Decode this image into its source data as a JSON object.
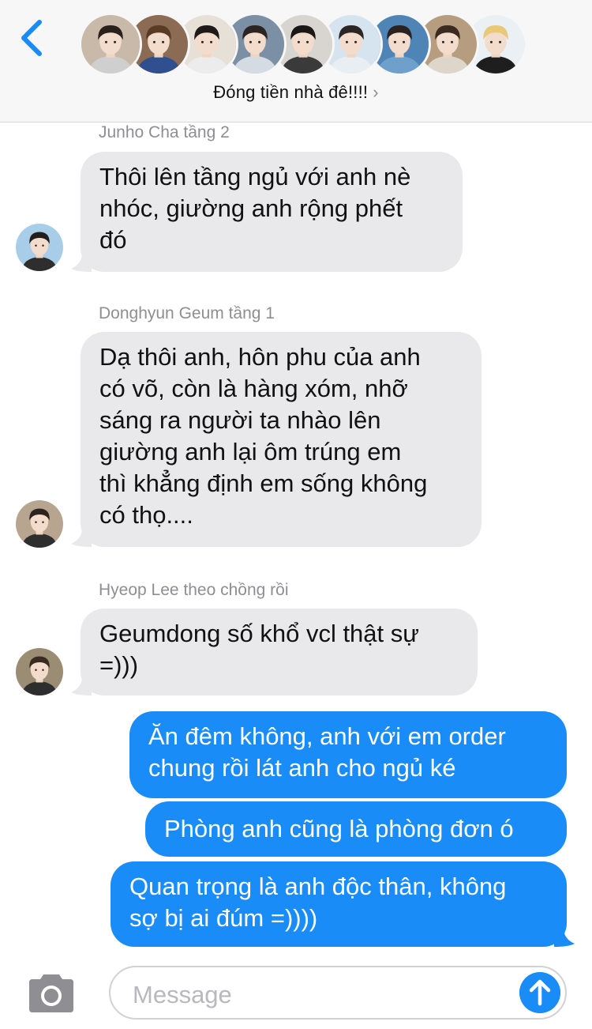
{
  "header": {
    "back_label": "Back",
    "group_name": "Đóng tiền nhà đê!!!!",
    "chevron": "›",
    "member_avatars": [
      {
        "icon": "avatar-1",
        "bg": "#c9b9a9",
        "hair": "#2b211c",
        "shirt": "#cfcfcf"
      },
      {
        "icon": "avatar-2",
        "bg": "#8b6b53",
        "hair": "#5a3b23",
        "shirt": "#2f4f8f"
      },
      {
        "icon": "avatar-3",
        "bg": "#e7e0d6",
        "hair": "#1f1a18",
        "shirt": "#ececec"
      },
      {
        "icon": "avatar-4",
        "bg": "#7b8fa5",
        "hair": "#2c2420",
        "shirt": "#d5dbe3"
      },
      {
        "icon": "avatar-5",
        "bg": "#d8d4cf",
        "hair": "#1b1716",
        "shirt": "#3a3a3a"
      },
      {
        "icon": "avatar-6",
        "bg": "#d6e4ef",
        "hair": "#2b2523",
        "shirt": "#e9eef2"
      },
      {
        "icon": "avatar-7",
        "bg": "#4f85b6",
        "hair": "#2a2220",
        "shirt": "#6fa0cc"
      },
      {
        "icon": "avatar-8",
        "bg": "#b79d80",
        "hair": "#3b2a1f",
        "shirt": "#ded6cb"
      },
      {
        "icon": "avatar-9",
        "bg": "#eaf0f4",
        "hair": "#e7c977",
        "shirt": "#1e1e1e"
      }
    ]
  },
  "messages": [
    {
      "type": "in",
      "sender": "Junho Cha tầng 2",
      "lines": [
        "Thôi lên tầng ngủ với anh nè",
        "nhóc, giường anh rộng phết",
        "đó"
      ],
      "avatar": {
        "bg": "#a7cde8",
        "hair": "#241d1b"
      }
    },
    {
      "type": "in",
      "sender": "Donghyun Geum tầng 1",
      "lines": [
        "Dạ thôi anh, hôn phu của anh",
        "có võ, còn là hàng xóm, nhỡ",
        "sáng ra người ta nhào lên",
        "giường anh lại ôm trúng em",
        "thì khẳng định em sống không",
        "có thọ...."
      ],
      "avatar": {
        "bg": "#b8a58f",
        "hair": "#2d231f"
      }
    },
    {
      "type": "in",
      "sender": "Hyeop Lee theo chồng rồi",
      "lines": [
        "Geumdong số khổ vcl thật sự",
        "=)))"
      ],
      "avatar": {
        "bg": "#9b8c74",
        "hair": "#3a2b22"
      }
    },
    {
      "type": "out",
      "lines": [
        "Ăn đêm không, anh với em order",
        "chung rồi lát anh cho ngủ ké"
      ]
    },
    {
      "type": "out",
      "lines": [
        "Phòng anh cũng là phòng đơn ó"
      ]
    },
    {
      "type": "out",
      "lines": [
        "Quan trọng là anh độc thân, không",
        "sợ bị ai đúm =))))"
      ]
    }
  ],
  "composer": {
    "placeholder": "Message",
    "camera_icon": "camera-icon",
    "send_icon": "arrow-up-icon"
  },
  "colors": {
    "accent": "#1a8cf8",
    "incoming_bubble": "#e9e9eb",
    "header_bg": "#f7f7f7",
    "sender_text": "#8e8e93"
  }
}
